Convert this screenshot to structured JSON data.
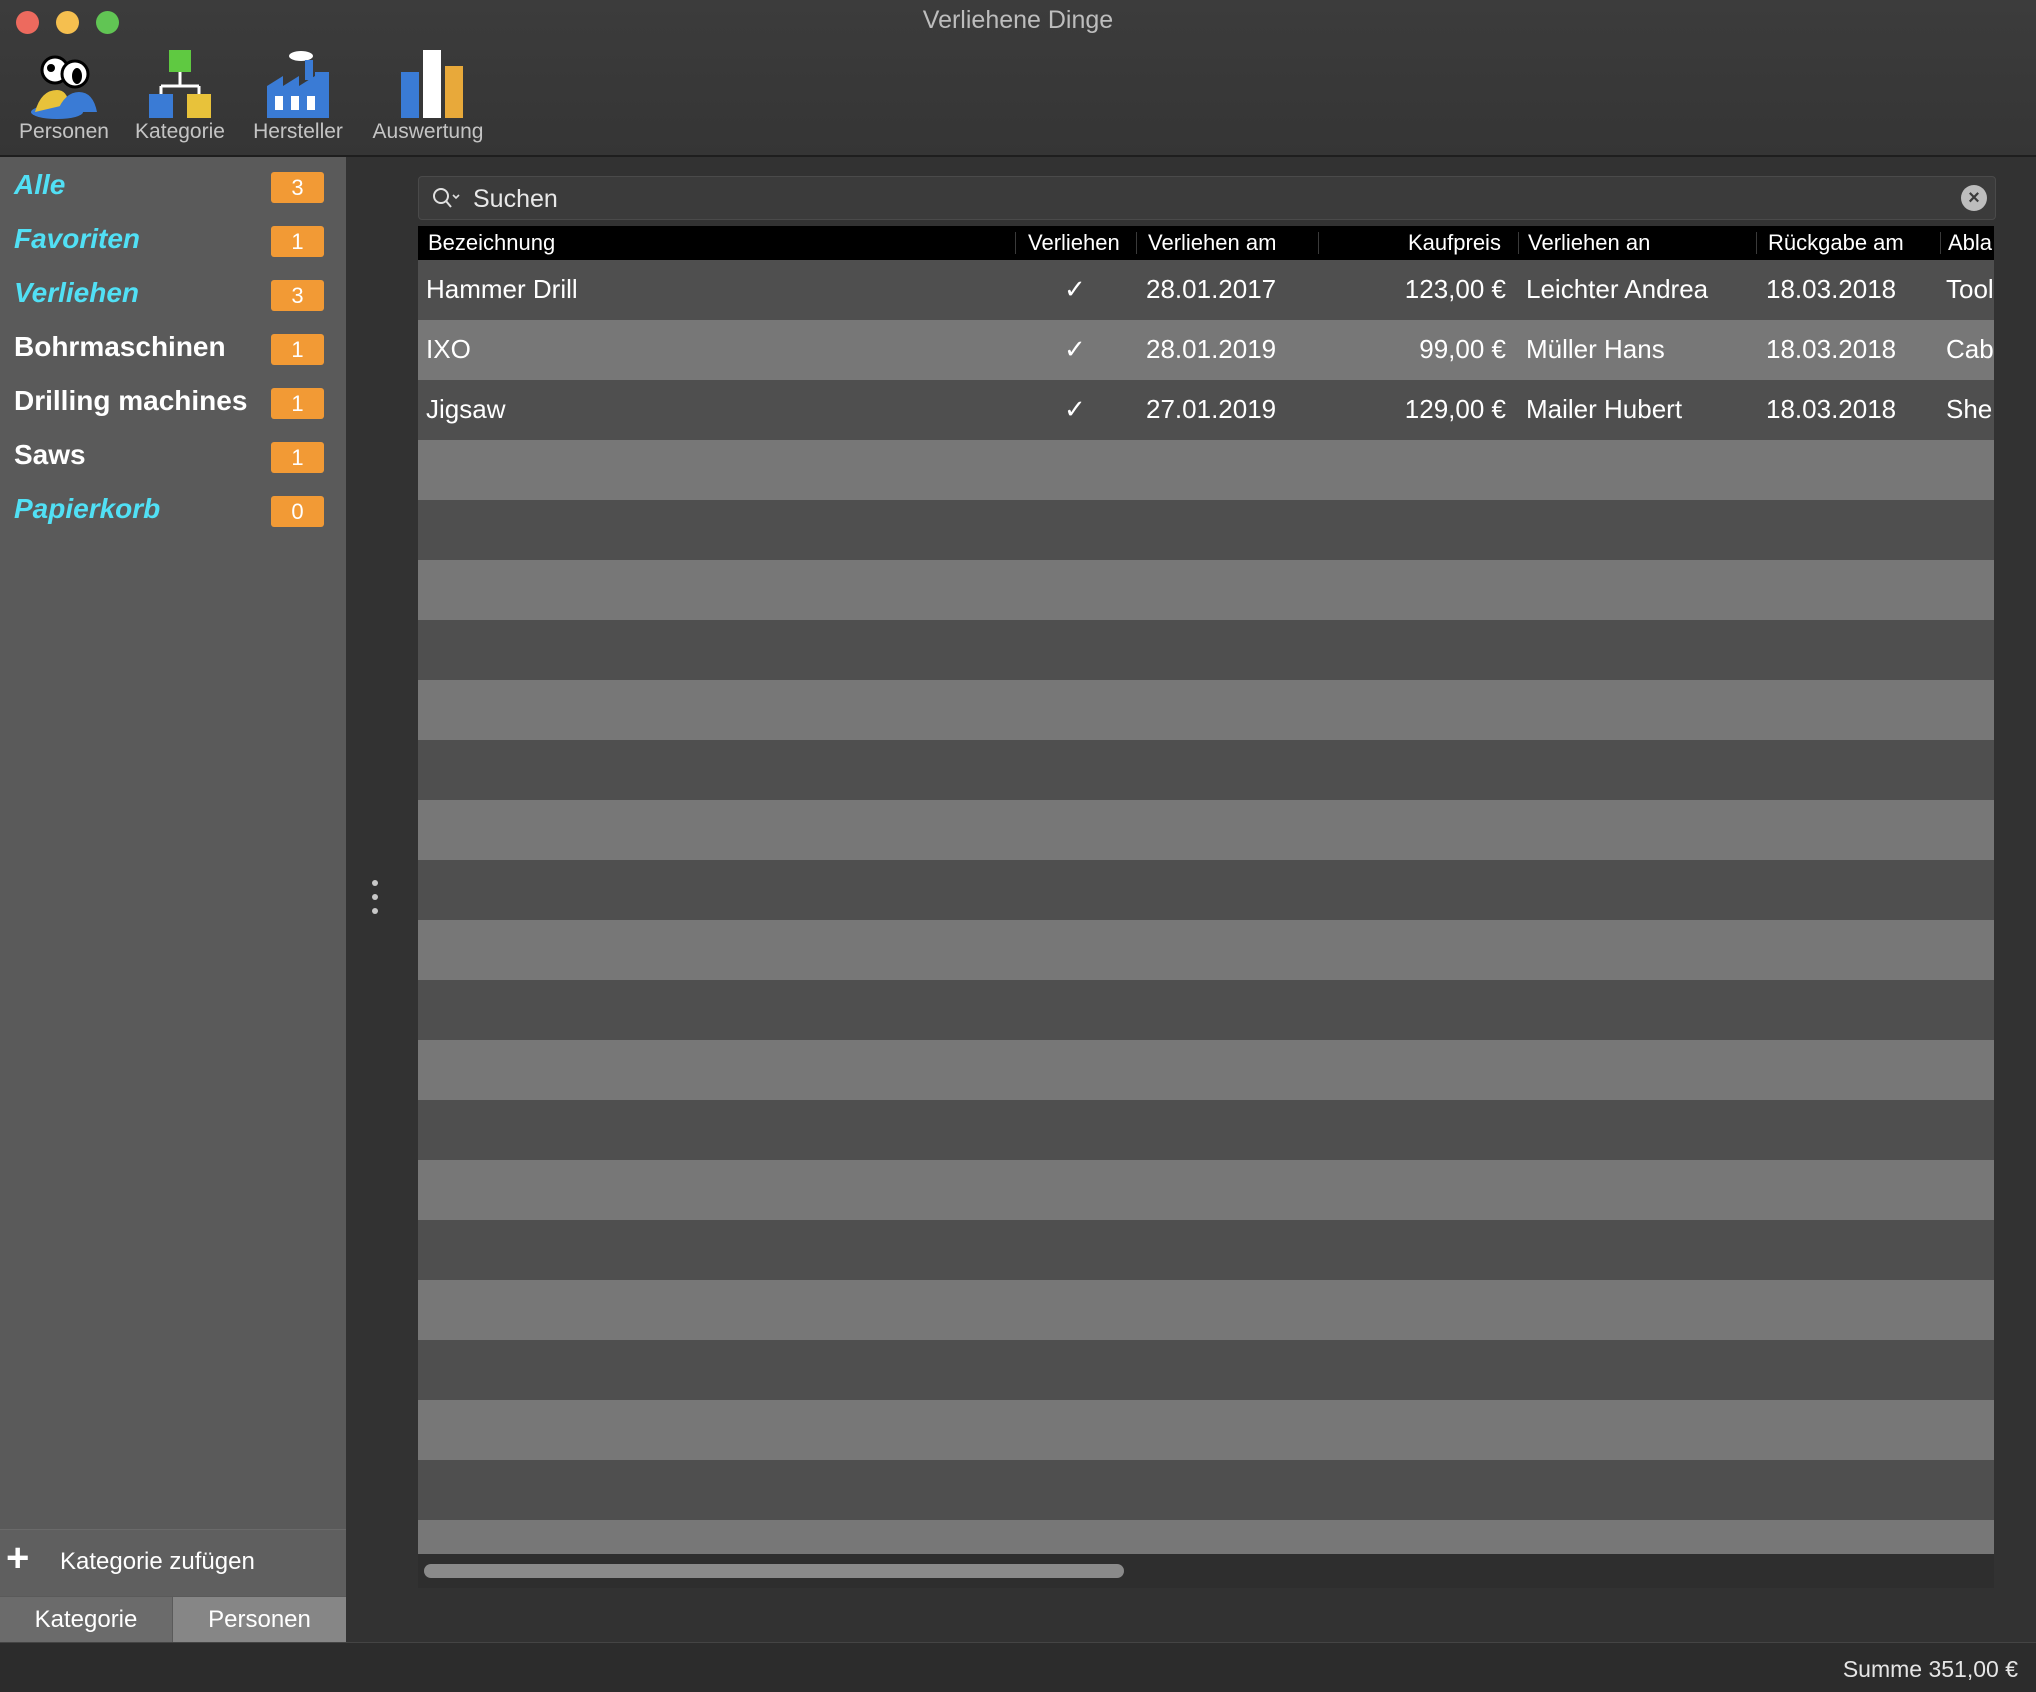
{
  "window": {
    "title": "Verliehene Dinge"
  },
  "toolbar": {
    "items": [
      {
        "label": "Personen",
        "icon": "persons-icon"
      },
      {
        "label": "Kategorie",
        "icon": "category-tree-icon"
      },
      {
        "label": "Hersteller",
        "icon": "factory-icon"
      },
      {
        "label": "Auswertung",
        "icon": "bar-chart-icon"
      }
    ]
  },
  "sidebar": {
    "items": [
      {
        "label": "Alle",
        "count": "3",
        "kind": "smart"
      },
      {
        "label": "Favoriten",
        "count": "1",
        "kind": "smart"
      },
      {
        "label": "Verliehen",
        "count": "3",
        "kind": "smart"
      },
      {
        "label": "Bohrmaschinen",
        "count": "1",
        "kind": "category"
      },
      {
        "label": "Drilling machines",
        "count": "1",
        "kind": "category"
      },
      {
        "label": "Saws",
        "count": "1",
        "kind": "category"
      },
      {
        "label": "Papierkorb",
        "count": "0",
        "kind": "smart"
      }
    ],
    "add_label": "Kategorie zufügen",
    "tabs": [
      {
        "label": "Kategorie",
        "active": true
      },
      {
        "label": "Personen",
        "active": false
      }
    ]
  },
  "search": {
    "placeholder": "Suchen"
  },
  "table": {
    "columns": [
      "Bezeichnung",
      "Verliehen",
      "Verliehen am",
      "Kaufpreis",
      "Verliehen an",
      "Rückgabe am",
      "Abla"
    ],
    "rows": [
      {
        "bezeichnung": "Hammer Drill",
        "verliehen": "✓",
        "verliehen_am": "28.01.2017",
        "kaufpreis": "123,00 €",
        "verliehen_an": "Leichter Andrea",
        "rueckgabe_am": "18.03.2018",
        "ablage": "Tool"
      },
      {
        "bezeichnung": "IXO",
        "verliehen": "✓",
        "verliehen_am": "28.01.2019",
        "kaufpreis": "99,00 €",
        "verliehen_an": "Müller Hans",
        "rueckgabe_am": "18.03.2018",
        "ablage": "Cab"
      },
      {
        "bezeichnung": "Jigsaw",
        "verliehen": "✓",
        "verliehen_am": "27.01.2019",
        "kaufpreis": "129,00 €",
        "verliehen_an": "Mailer Hubert",
        "rueckgabe_am": "18.03.2018",
        "ablage": "She"
      }
    ]
  },
  "status": {
    "sum": "Summe 351,00 €"
  },
  "colors": {
    "smart_item": "#51e0f5",
    "badge": "#f29a35"
  }
}
